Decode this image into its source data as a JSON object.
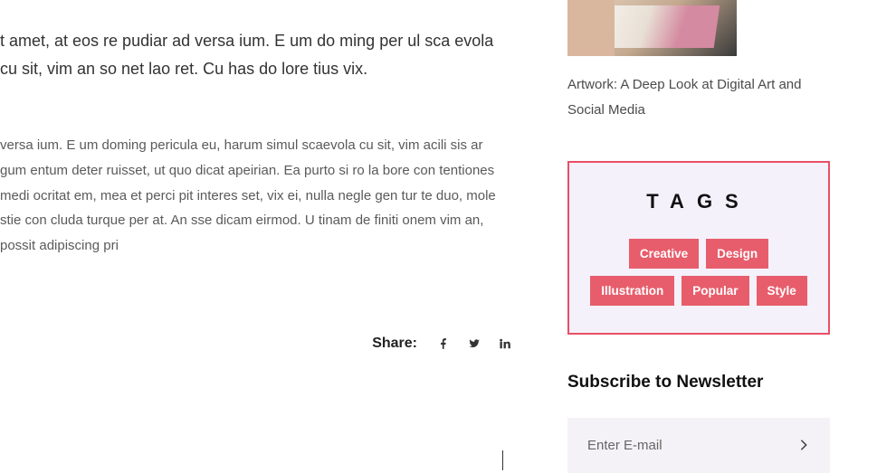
{
  "article": {
    "para1": "t amet, at eos re pudiar ad versa ium. E um do ming per ul sca evola cu sit, vim an so net lao ret. Cu has do lore tius vix.",
    "para2": "versa ium. E um doming pericula eu, harum simul scaevola cu sit, vim acili sis ar gum entum deter ruisset, ut quo dicat apeirian. Ea purto si ro la bore con tentiones medi ocritat em, mea et perci pit interes set, vix ei, nulla negle gen tur te duo, mole stie con cluda turque per at. An sse dicam eirmod. U tinam de finiti onem vim an, possit adipiscing pri"
  },
  "share": {
    "label": "Share:"
  },
  "sidebar": {
    "postTitle": "Artwork: A Deep Look at Digital Art and Social Media",
    "tags": {
      "heading": "TAGS",
      "items": [
        "Creative",
        "Design",
        "Illustration",
        "Popular",
        "Style"
      ]
    },
    "subscribe": {
      "heading": "Subscribe to Newsletter",
      "placeholder": "Enter E-mail"
    }
  }
}
